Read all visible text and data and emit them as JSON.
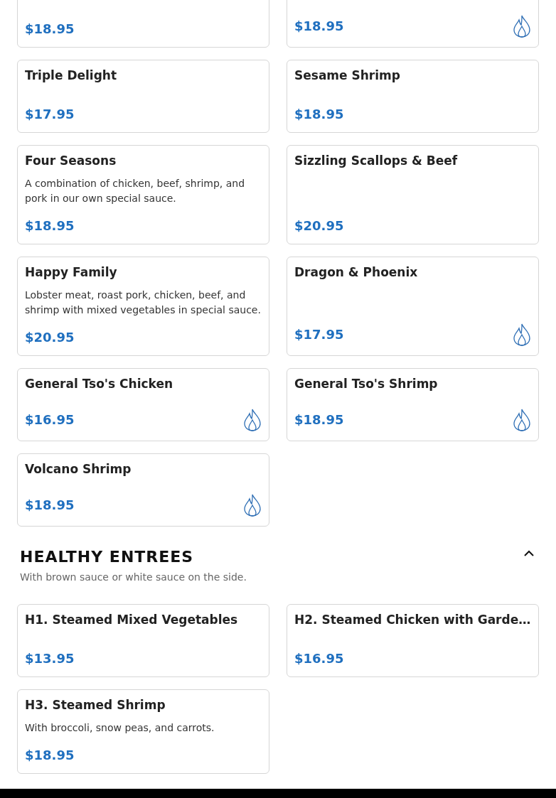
{
  "sections": [
    {
      "items": [
        {
          "kind": "cut",
          "price": "$18.95",
          "spicy": false
        },
        {
          "kind": "cut",
          "price": "$18.95",
          "spicy": true
        },
        {
          "kind": "full",
          "name": "Triple Delight",
          "price": "$17.95",
          "spicy": false
        },
        {
          "kind": "full",
          "name": "Sesame Shrimp",
          "price": "$18.95",
          "spicy": false
        },
        {
          "kind": "full",
          "name": "Four Seasons",
          "description": "A combination of chicken, beef, shrimp, and pork in our own special sauce.",
          "price": "$18.95",
          "spicy": false
        },
        {
          "kind": "full",
          "name": "Sizzling Scallops & Beef",
          "price": "$20.95",
          "spicy": false
        },
        {
          "kind": "full",
          "name": "Happy Family",
          "description": "Lobster meat, roast pork, chicken, beef, and shrimp with mixed vegetables in special sauce.",
          "price": "$20.95",
          "spicy": false
        },
        {
          "kind": "full",
          "name": "Dragon & Phoenix",
          "price": "$17.95",
          "spicy": true
        },
        {
          "kind": "full",
          "name": "General Tso's Chicken",
          "price": "$16.95",
          "spicy": true
        },
        {
          "kind": "full",
          "name": "General Tso's Shrimp",
          "price": "$18.95",
          "spicy": true
        },
        {
          "kind": "full",
          "name": "Volcano Shrimp",
          "price": "$18.95",
          "spicy": true
        }
      ]
    },
    {
      "title": "HEALTHY ENTREES",
      "subtitle": "With brown sauce or white sauce on the side.",
      "expanded": true,
      "items": [
        {
          "kind": "full",
          "name": "H1. Steamed Mixed Vegetables",
          "price": "$13.95",
          "spicy": false
        },
        {
          "kind": "full",
          "name": "H2. Steamed Chicken with Garde…",
          "price": "$16.95",
          "spicy": false
        },
        {
          "kind": "full",
          "name": "H3. Steamed Shrimp",
          "description": "With broccoli, snow peas, and carrots.",
          "price": "$18.95",
          "spicy": false
        }
      ]
    }
  ]
}
